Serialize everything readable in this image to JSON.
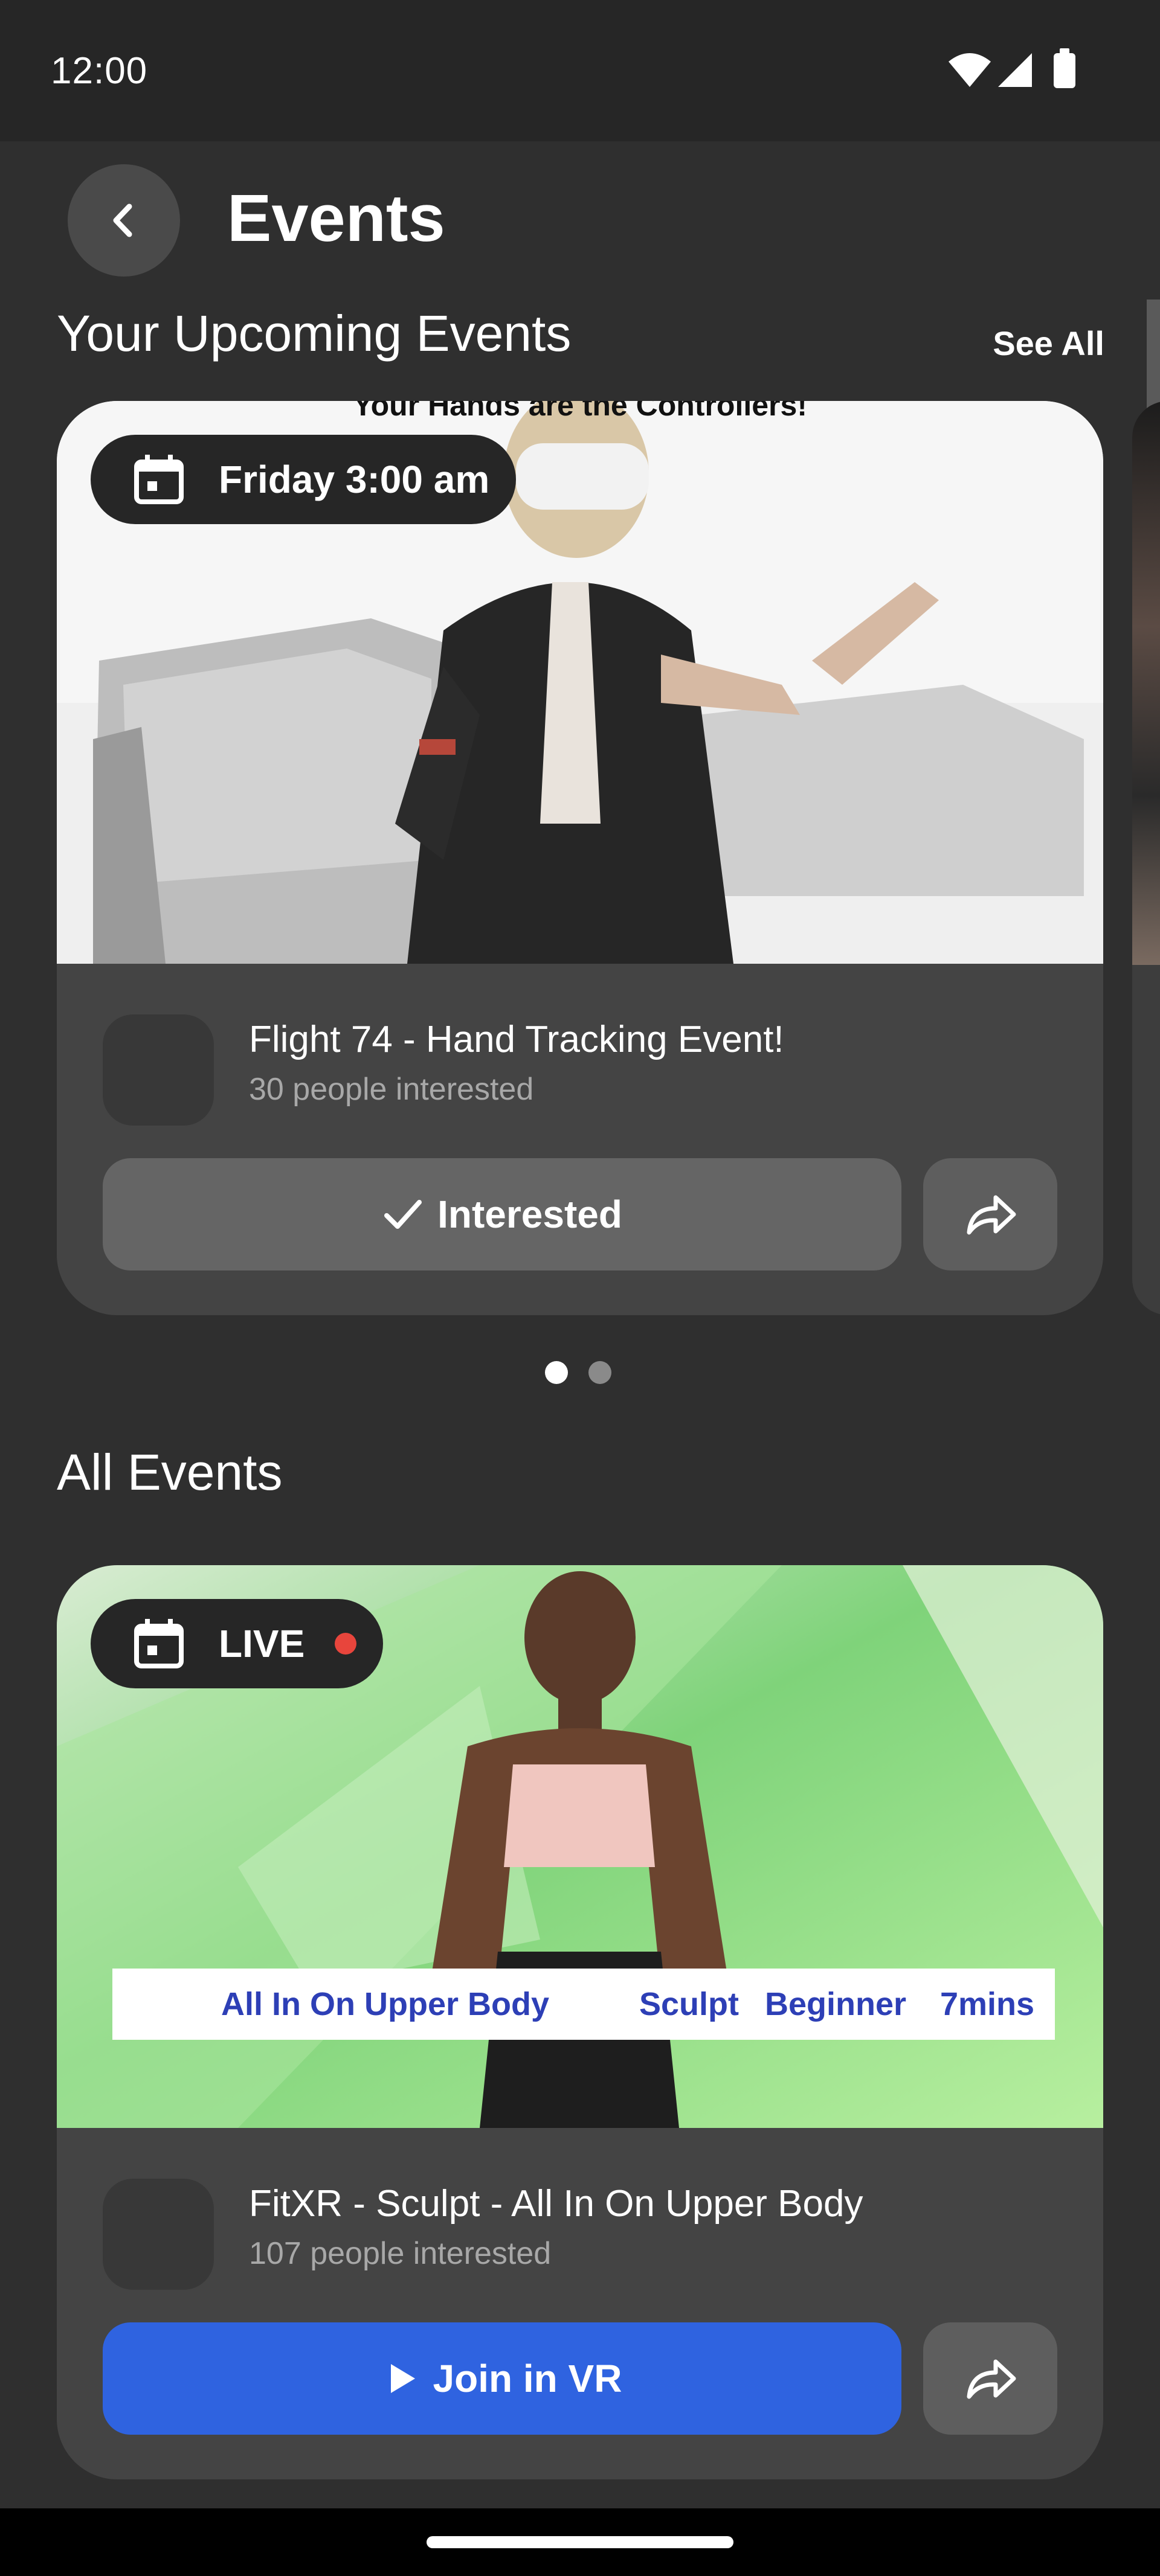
{
  "status": {
    "time": "12:00"
  },
  "header": {
    "title": "Events"
  },
  "upcoming": {
    "section_title": "Your Upcoming Events",
    "see_all": "See All",
    "cards": [
      {
        "badge_text": "Friday 3:00 am",
        "image_caption": "Your Hands are the Controllers!",
        "title": "Flight 74 - Hand Tracking Event!",
        "interested_count": "30 people interested",
        "button_label": "Interested"
      }
    ],
    "pagination": {
      "total": 2,
      "active": 1
    }
  },
  "all_events": {
    "section_title": "All Events",
    "cards": [
      {
        "badge_text": "LIVE",
        "banner": {
          "left": "All In On Upper Body",
          "mid": "Sculpt",
          "level": "Beginner",
          "duration": "7mins"
        },
        "title": "FitXR - Sculpt - All In On Upper Body",
        "interested_count": "107 people interested",
        "button_label": "Join in VR"
      }
    ]
  },
  "colors": {
    "background": "#2f2f2f",
    "card": "#444444",
    "primary": "#2f63e0",
    "live": "#e8453c"
  },
  "icons": [
    "back-arrow-icon",
    "calendar-icon",
    "check-icon",
    "play-icon",
    "share-icon",
    "wifi-icon",
    "signal-icon",
    "battery-icon"
  ]
}
